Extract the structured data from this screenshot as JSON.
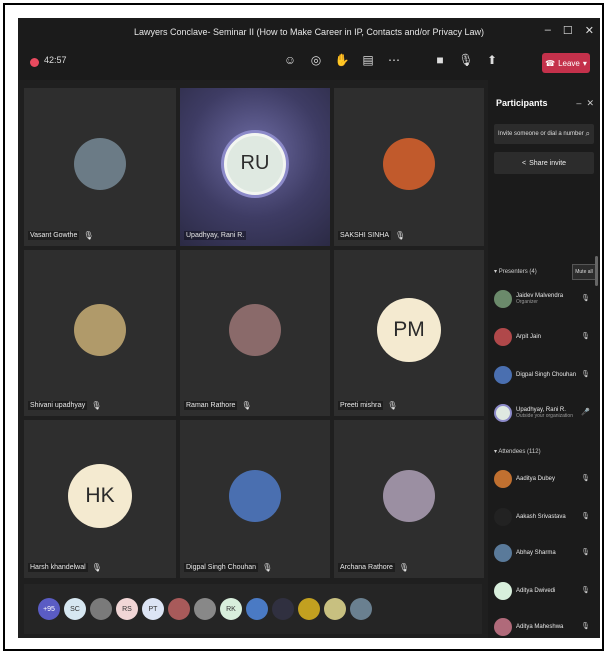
{
  "window": {
    "title": "Lawyers Conclave- Seminar II (How to Make Career in IP, Contacts and/or Privacy Law)",
    "controls": [
      "–",
      "☐",
      "✕"
    ]
  },
  "toolbar": {
    "timer": "42:57",
    "leave_label": "Leave"
  },
  "tiles": [
    {
      "name": "Vasant Gowthe",
      "type": "photo",
      "color": "#6b7b86"
    },
    {
      "name": "Upadhyay, Rani R.",
      "type": "initials",
      "initials": "RU",
      "highlight": true
    },
    {
      "name": "SAKSHI SINHA",
      "type": "photo",
      "color": "#c15a2c"
    },
    {
      "name": "Shivani upadhyay",
      "type": "photo",
      "color": "#b09a6a"
    },
    {
      "name": "Raman Rathore",
      "type": "photo",
      "color": "#8a6a6a"
    },
    {
      "name": "Preeti mishra",
      "type": "initials",
      "initials": "PM"
    },
    {
      "name": "Harsh khandelwal",
      "type": "initials",
      "initials": "HK"
    },
    {
      "name": "Digpal Singh Chouhan",
      "type": "photo",
      "color": "#4a6fb0"
    },
    {
      "name": "Archana Rathore",
      "type": "photo",
      "color": "#9b8fa2"
    }
  ],
  "strip": [
    {
      "label": "+95",
      "color": "#5a5cc4",
      "text": "#ffffff"
    },
    {
      "label": "SC",
      "color": "#d6e7f1",
      "text": "#333333"
    },
    {
      "label": "",
      "color": "#7a7a7a",
      "text": "#333333"
    },
    {
      "label": "RS",
      "color": "#f1d6d6",
      "text": "#333333"
    },
    {
      "label": "PT",
      "color": "#dce4f4",
      "text": "#333333"
    },
    {
      "label": "",
      "color": "#a85a5a",
      "text": "#333333"
    },
    {
      "label": "",
      "color": "#888888",
      "text": "#333333"
    },
    {
      "label": "RK",
      "color": "#d8efdc",
      "text": "#333333"
    },
    {
      "label": "",
      "color": "#4a7ac4",
      "text": "#333333"
    },
    {
      "label": "",
      "color": "#303040",
      "text": "#333333"
    },
    {
      "label": "",
      "color": "#c2a020",
      "text": "#333333"
    },
    {
      "label": "",
      "color": "#c8c080",
      "text": "#333333"
    },
    {
      "label": "",
      "color": "#6a8090",
      "text": "#333333"
    }
  ],
  "participants_panel": {
    "title": "Participants",
    "search_placeholder": "Invite someone or dial a number",
    "share_invite": "Share invite",
    "presenters_label": "Presenters (4)",
    "mute_all": "Mute all",
    "attendees_label": "Attendees (112)",
    "presenters": [
      {
        "name": "Jaidev Malvendra",
        "sub": "Organizer"
      },
      {
        "name": "Arpit Jain",
        "sub": ""
      },
      {
        "name": "Digpal Singh Chouhan",
        "sub": ""
      },
      {
        "name": "Upadhyay, Rani R.",
        "sub": "Outside your organization"
      }
    ],
    "attendees": [
      {
        "name": "Aaditya Dubey"
      },
      {
        "name": "Aakash Srivastava"
      },
      {
        "name": "Abhay Sharma"
      },
      {
        "name": "Aditya Dwivedi"
      },
      {
        "name": "Aditya Maheshwa"
      }
    ]
  }
}
